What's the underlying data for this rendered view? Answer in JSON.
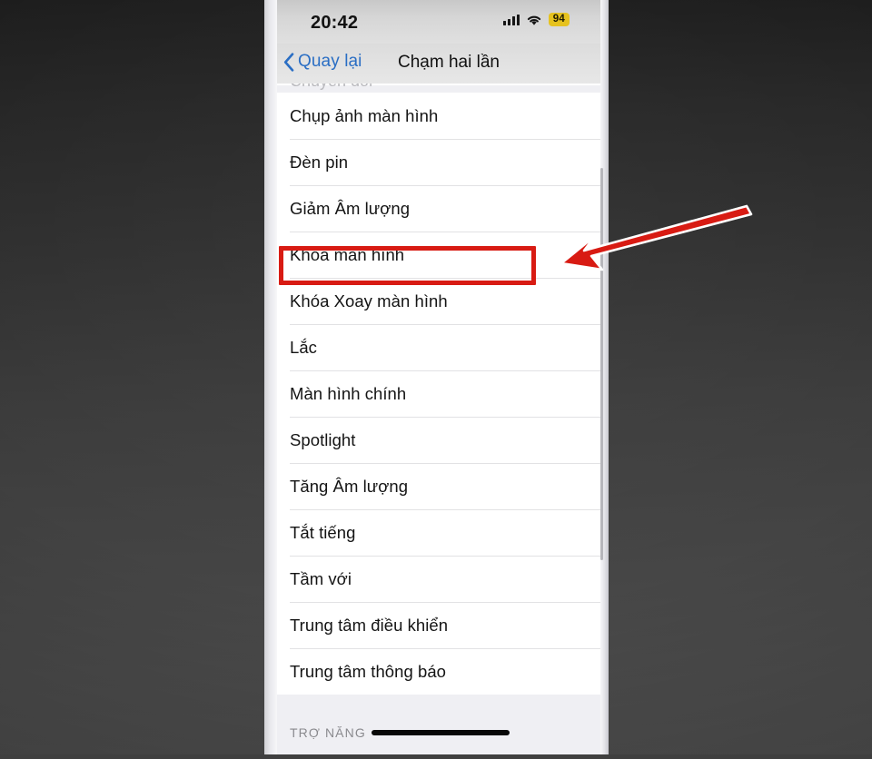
{
  "status_bar": {
    "time": "20:42",
    "cellular_icon": "cellular-bars-icon",
    "wifi_icon": "wifi-icon",
    "battery_percent": "94",
    "battery_badge_color": "#e6c21e"
  },
  "nav_bar": {
    "back_icon": "chevron-left-icon",
    "back_label": "Quay lại",
    "title": "Chạm hai lần",
    "back_link_color": "#2a6ec4"
  },
  "list": {
    "clipped_top_item": "Chuyển đổi",
    "items": [
      {
        "label": "Chụp ảnh màn hình"
      },
      {
        "label": "Đèn pin"
      },
      {
        "label": "Giảm Âm lượng"
      },
      {
        "label": "Khóa màn hình"
      },
      {
        "label": "Khóa Xoay màn hình"
      },
      {
        "label": "Lắc"
      },
      {
        "label": "Màn hình chính"
      },
      {
        "label": "Spotlight"
      },
      {
        "label": "Tăng Âm lượng"
      },
      {
        "label": "Tắt tiếng"
      },
      {
        "label": "Tầm với"
      },
      {
        "label": "Trung tâm điều khiển"
      },
      {
        "label": "Trung tâm thông báo"
      }
    ]
  },
  "footer": {
    "section_label": "TRỢ NĂNG",
    "home_indicator": "home-indicator-bar"
  },
  "annotations": {
    "highlight_target": "Khóa màn hình",
    "highlight_color": "#d81b13",
    "arrow_color": "#d81b13",
    "arrow_outline_color": "#ffffff",
    "arrow_direction": "points-left-down-to-highlight"
  }
}
